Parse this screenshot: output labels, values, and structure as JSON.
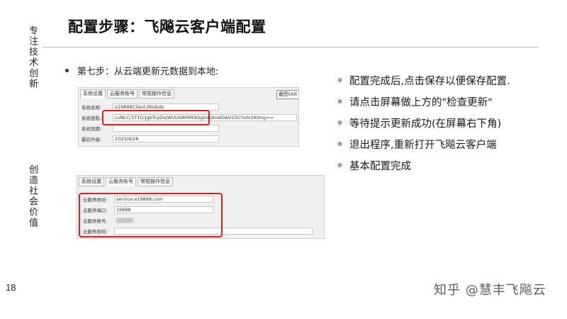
{
  "slide": {
    "title": "配置步骤：飞飚云客户端配置",
    "side_text_top": "专注技术创新",
    "side_text_bottom": "创造社会价值",
    "page_number": "18",
    "step": "第七步：从云端更新元数据到本地:"
  },
  "panel1": {
    "tabs": [
      "系统设置",
      "云服务账号",
      "常规操作信息"
    ],
    "shortcut_button": "截图(Alt",
    "fields": [
      {
        "label": "系统名称:",
        "value": "e19888Client.Module"
      },
      {
        "label": "系统密匙:",
        "value": "LUNLC/1T1CrJgbTcyDxjWUUS8HMt9GgInRdmADwV15CYs0cI/ktmg=="
      },
      {
        "label": "系统到期:",
        "value": ""
      },
      {
        "label": "最后升级:",
        "value": "2023/4/28"
      }
    ]
  },
  "panel2": {
    "tabs": [
      "系统设置",
      "云服务账号",
      "常规操作信息"
    ],
    "fields": [
      {
        "label": "云服务地址:",
        "value": "service.e19888.com"
      },
      {
        "label": "云服务端口:",
        "value": "16888"
      },
      {
        "label": "云服务账号:",
        "value": ""
      },
      {
        "label": "云服务密码:",
        "value": ""
      }
    ]
  },
  "notes": [
    "配置完成后,点击保存以便保存配置.",
    "请点击屏幕做上方的\"检查更新\"",
    "等待提示更新成功(在屏幕右下角)",
    "退出程序,重新打开飞飚云客户端",
    "基本配置完成"
  ],
  "watermark": "知乎 @慧丰飞飚云"
}
